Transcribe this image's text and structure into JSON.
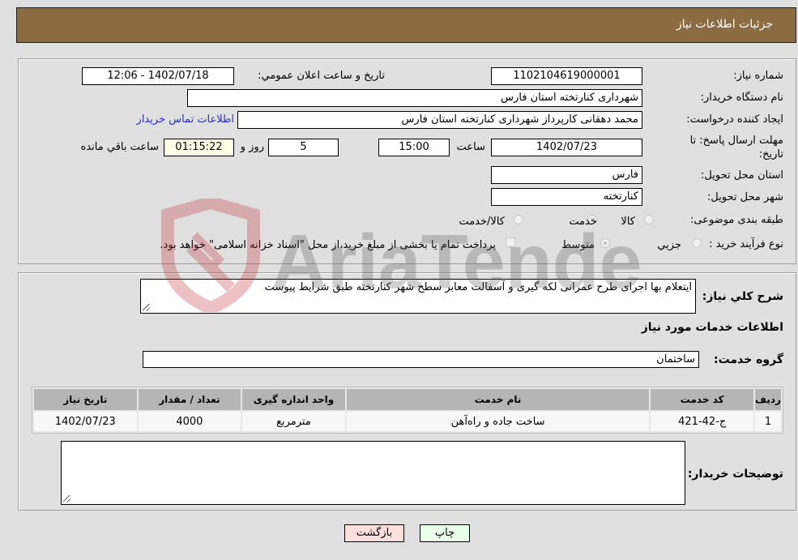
{
  "header": {
    "title": "جزئیات اطلاعات نیاز"
  },
  "form": {
    "need_number": {
      "label": "شماره نیاز:",
      "value": "1102104619000001"
    },
    "announce_datetime": {
      "label": "تاریخ و ساعت اعلان عمومي:",
      "value": "1402/07/18 - 12:06"
    },
    "buyer_org": {
      "label": "نام دستگاه خریدار:",
      "value": "شهرداری کنارتخته استان فارس"
    },
    "requester": {
      "label": "ایجاد کننده درخواست:",
      "value": "محمد دهقانی کارپرداز شهرداری کنارتخته استان فارس"
    },
    "buyer_contact_link": "اطلاعات تماس خریدار",
    "deadline": {
      "label_line1": "مهلت ارسال پاسخ: تا",
      "label_line2": "تاریخ:",
      "date": "1402/07/23",
      "time_label": "ساعت",
      "time": "15:00",
      "days": "5",
      "days_label": "روز و",
      "remaining": "01:15:22",
      "remaining_label": "ساعت باقي مانده"
    },
    "delivery_province": {
      "label": "استان محل تحویل:",
      "value": "فارس"
    },
    "delivery_city": {
      "label": "شهر محل تحویل:",
      "value": "کنارتخته"
    },
    "category": {
      "label": "طبقه بندی موضوعی:",
      "options": [
        "کالا",
        "خدمت",
        "کالا/خدمت"
      ],
      "selected": "خدمت"
    },
    "purchase_type": {
      "label": "نوع فرآیند خرید :",
      "options": [
        "جزيي",
        "متوسط"
      ],
      "selected": "متوسط",
      "treasury_checkbox_label": "پرداخت تمام یا بخشی از مبلغ خرید،از محل \"اسناد خزانه اسلامی\" خواهد بود.",
      "treasury_checked": false
    }
  },
  "details": {
    "description_label": "شرح کلي نیاز:",
    "description": "ایتعلام بها اجرای طرح عمرانی لکه گیری و آسفالت معابر سطح شهر کنارتخته طبق شرایط پیوست",
    "services_heading": "اطلاعات خدمات مورد نیاز",
    "service_group_label": "گروه خدمت:",
    "service_group": "ساختمان",
    "table": {
      "headers": [
        "ردیف",
        "کد خدمت",
        "نام خدمت",
        "واحد اندازه گیری",
        "تعداد / مقدار",
        "تاریخ نیاز"
      ],
      "rows": [
        [
          "1",
          "ج-42-421",
          "ساخت جاده و راه‌آهن",
          "مترمربع",
          "4000",
          "1402/07/23"
        ]
      ]
    },
    "buyer_notes_label": "توضیحات خریدار:",
    "buyer_notes": ""
  },
  "buttons": {
    "print": "چاپ",
    "back": "بازگشت"
  },
  "watermark": {
    "text": "AriaTender.net"
  }
}
